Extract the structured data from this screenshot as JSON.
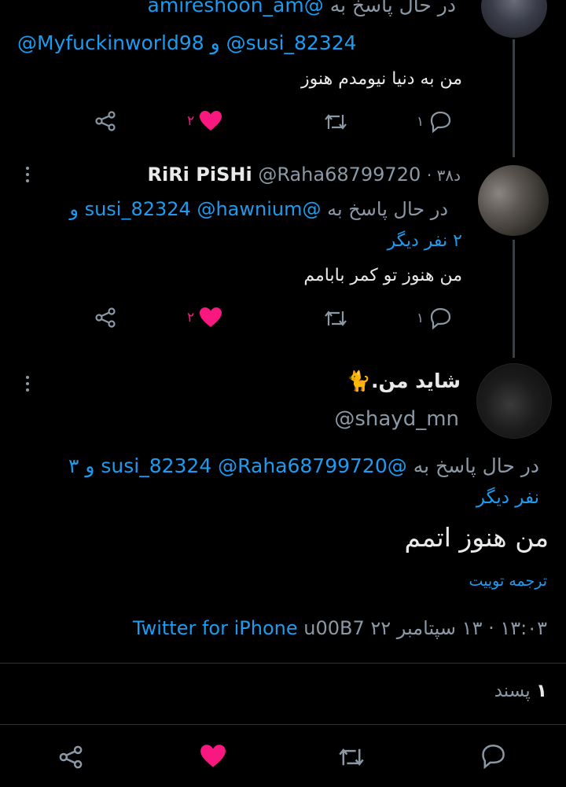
{
  "tweet1": {
    "reply_prefix": "در حال پاسخ به",
    "handle_top": "@amireshoon_am",
    "handle_mid": "@susi_82324",
    "conj": "و",
    "handle_left": "@Myfuckinworld98",
    "text": "من به دنیا نیومدم هنوز",
    "likes": "۲",
    "replies": "۱"
  },
  "tweet2": {
    "name": "RiRi PiSHi",
    "handle": "@Raha68799720",
    "time": "· ۳۸د",
    "reply_prefix": "در حال پاسخ به",
    "handles": "@susi_82324 @hawnium",
    "conj": "و",
    "others": "۲ نفر دیگر",
    "text": "من هنوز تو کمر بابامم",
    "likes": "۲",
    "replies": "۱"
  },
  "main": {
    "name": "شاید من.",
    "emoji": "🐈",
    "handle": "@shayd_mn",
    "reply_prefix": "در حال پاسخ به",
    "handles": "@susi_82324 @Raha68799720",
    "conj": "و ۳",
    "others": "نفر دیگر",
    "text": "من هنوز اتمم",
    "translate": "ترجمه توییت",
    "meta_time": "۱۳:۰۳ · ۱۳ سپتامبر ۲۲",
    "meta_sep": "u00B7",
    "meta_source": "Twitter for iPhone",
    "likes_count": "۱",
    "likes_label": "پسند"
  },
  "colors": {
    "accent": "#1d9bf0",
    "like": "#f91880",
    "muted": "#8b98a5"
  },
  "icons": [
    "share-icon",
    "heart-icon",
    "retweet-icon",
    "reply-icon",
    "more-icon"
  ]
}
